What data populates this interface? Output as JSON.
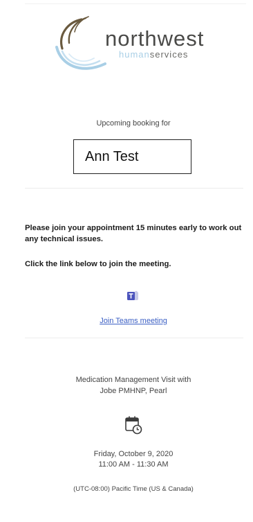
{
  "logo": {
    "word": "northwest",
    "sub_light": "human",
    "sub_dark": "services",
    "colors": {
      "swoosh_dark": "#6a5a3f",
      "swoosh_light": "#a9cfe6",
      "text": "#4a4a48"
    }
  },
  "booking": {
    "label": "Upcoming booking for",
    "name": "Ann Test"
  },
  "notice": {
    "line1": "Please join your appointment 15 minutes early to work out any technical issues.",
    "line2": "Click the link below to join the meeting."
  },
  "teams": {
    "icon": "teams-icon",
    "link_label": "Join Teams meeting",
    "link_color": "#3b5fc4"
  },
  "visit": {
    "title": "Medication Management Visit with",
    "provider": "Jobe PMHNP, Pearl",
    "icon": "calendar-clock-icon",
    "date": "Friday, October 9, 2020",
    "time": "11:00 AM - 11:30 AM",
    "timezone": "(UTC-08:00) Pacific Time (US & Canada)"
  }
}
